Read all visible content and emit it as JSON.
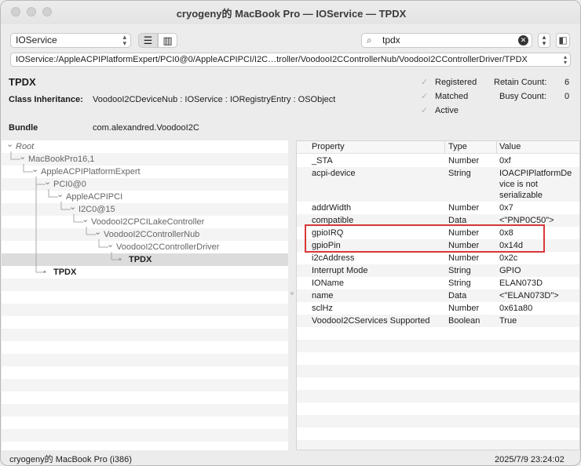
{
  "window": {
    "title": "cryogeny的 MacBook Pro — IOService — TPDX"
  },
  "toolbar": {
    "plane_select": "IOService",
    "search_text": "tpdx",
    "list_icon": "list-icon",
    "column_icon": "columns-icon"
  },
  "path": "IOService:/AppleACPIPlatformExpert/PCI0@0/AppleACPIPCI/I2C…troller/VoodooI2CControllerNub/VoodooI2CControllerDriver/TPDX",
  "info": {
    "name": "TPDX",
    "class_label": "Class Inheritance:",
    "class_value": "VoodooI2CDeviceNub : IOService : IORegistryEntry : OSObject",
    "bundle_label": "Bundle",
    "bundle_value": "com.alexandred.VoodooI2C",
    "flags": {
      "registered": "Registered",
      "matched": "Matched",
      "active": "Active"
    },
    "retain_label": "Retain Count:",
    "retain_value": "6",
    "busy_label": "Busy Count:",
    "busy_value": "0"
  },
  "tree": [
    {
      "label": "Root",
      "depth": 0,
      "italic": true
    },
    {
      "label": "MacBookPro16,1",
      "depth": 1
    },
    {
      "label": "AppleACPIPlatformExpert",
      "depth": 2
    },
    {
      "label": "PCI0@0",
      "depth": 3
    },
    {
      "label": "AppleACPIPCI",
      "depth": 4
    },
    {
      "label": "I2C0@15",
      "depth": 5
    },
    {
      "label": "VoodooI2CPCILakeController",
      "depth": 6
    },
    {
      "label": "VoodooI2CControllerNub",
      "depth": 7
    },
    {
      "label": "VoodooI2CControllerDriver",
      "depth": 8
    },
    {
      "label": "TPDX",
      "depth": 9,
      "bold": true,
      "selected": true
    },
    {
      "label": "TPDX",
      "depth": 3,
      "bold": true
    }
  ],
  "props": {
    "headers": {
      "property": "Property",
      "type": "Type",
      "value": "Value"
    },
    "rows": [
      {
        "property": "_STA",
        "type": "Number",
        "value": "0xf"
      },
      {
        "property": "acpi-device",
        "type": "String",
        "value": "IOACPIPlatformDe\nvice is not\nserializable"
      },
      {
        "property": "addrWidth",
        "type": "Number",
        "value": "0x7"
      },
      {
        "property": "compatible",
        "type": "Data",
        "value": "<\"PNP0C50\">"
      },
      {
        "property": "gpioIRQ",
        "type": "Number",
        "value": "0x8"
      },
      {
        "property": "gpioPin",
        "type": "Number",
        "value": "0x14d"
      },
      {
        "property": "i2cAddress",
        "type": "Number",
        "value": "0x2c"
      },
      {
        "property": "Interrupt Mode",
        "type": "String",
        "value": "GPIO"
      },
      {
        "property": "IOName",
        "type": "String",
        "value": "ELAN073D"
      },
      {
        "property": "name",
        "type": "Data",
        "value": "<\"ELAN073D\">"
      },
      {
        "property": "sclHz",
        "type": "Number",
        "value": "0x61a80"
      },
      {
        "property": "VoodooI2CServices Supported",
        "type": "Boolean",
        "value": "True"
      }
    ]
  },
  "status": {
    "left": "cryogeny的 MacBook Pro (i386)",
    "right": "2025/7/9 23:24:02"
  }
}
